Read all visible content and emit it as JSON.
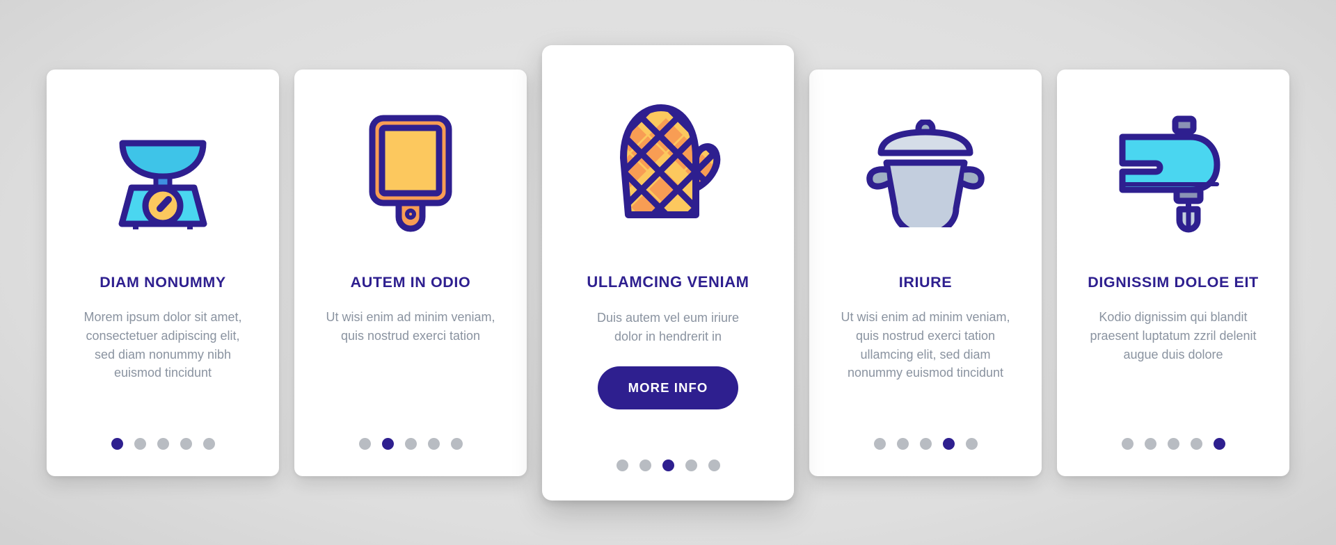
{
  "theme": {
    "accent_indigo": "#2e1f8f",
    "cyan": "#4ad6f0",
    "orange": "#f89d54",
    "yellow": "#fcc85e",
    "body_text_grey": "#8a93a0",
    "dot_inactive_grey": "#b8bcc2",
    "pot_grey_blue": "#c3cede",
    "card_background": "#ffffff",
    "page_background": "#d9d9d9"
  },
  "pager": {
    "total_dots": 5
  },
  "cards": [
    {
      "icon": "kitchen-scale-icon",
      "title": "DIAM NONUMMY",
      "body": "Morem ipsum dolor sit amet, consectetuer adipiscing elit, sed diam nonummy nibh euismod tincidunt",
      "active_dot": 1,
      "featured": false,
      "button": null
    },
    {
      "icon": "cutting-board-icon",
      "title": "AUTEM IN ODIO",
      "body": "Ut wisi enim ad minim veniam, quis nostrud exerci tation",
      "active_dot": 2,
      "featured": false,
      "button": null
    },
    {
      "icon": "oven-mitt-icon",
      "title": "ULLAMCING VENIAM",
      "body": "Duis autem vel eum iriure dolor in hendrerit in",
      "active_dot": 3,
      "featured": true,
      "button": "MORE INFO"
    },
    {
      "icon": "cooking-pot-icon",
      "title": "IRIURE",
      "body": "Ut wisi enim ad minim veniam, quis nostrud exerci tation ullamcing elit, sed diam nonummy euismod tincidunt",
      "active_dot": 4,
      "featured": false,
      "button": null
    },
    {
      "icon": "hand-mixer-icon",
      "title": "DIGNISSIM DOLOE EIT",
      "body": "Kodio dignissim qui blandit praesent luptatum zzril delenit augue duis dolore",
      "active_dot": 5,
      "featured": false,
      "button": null
    }
  ]
}
